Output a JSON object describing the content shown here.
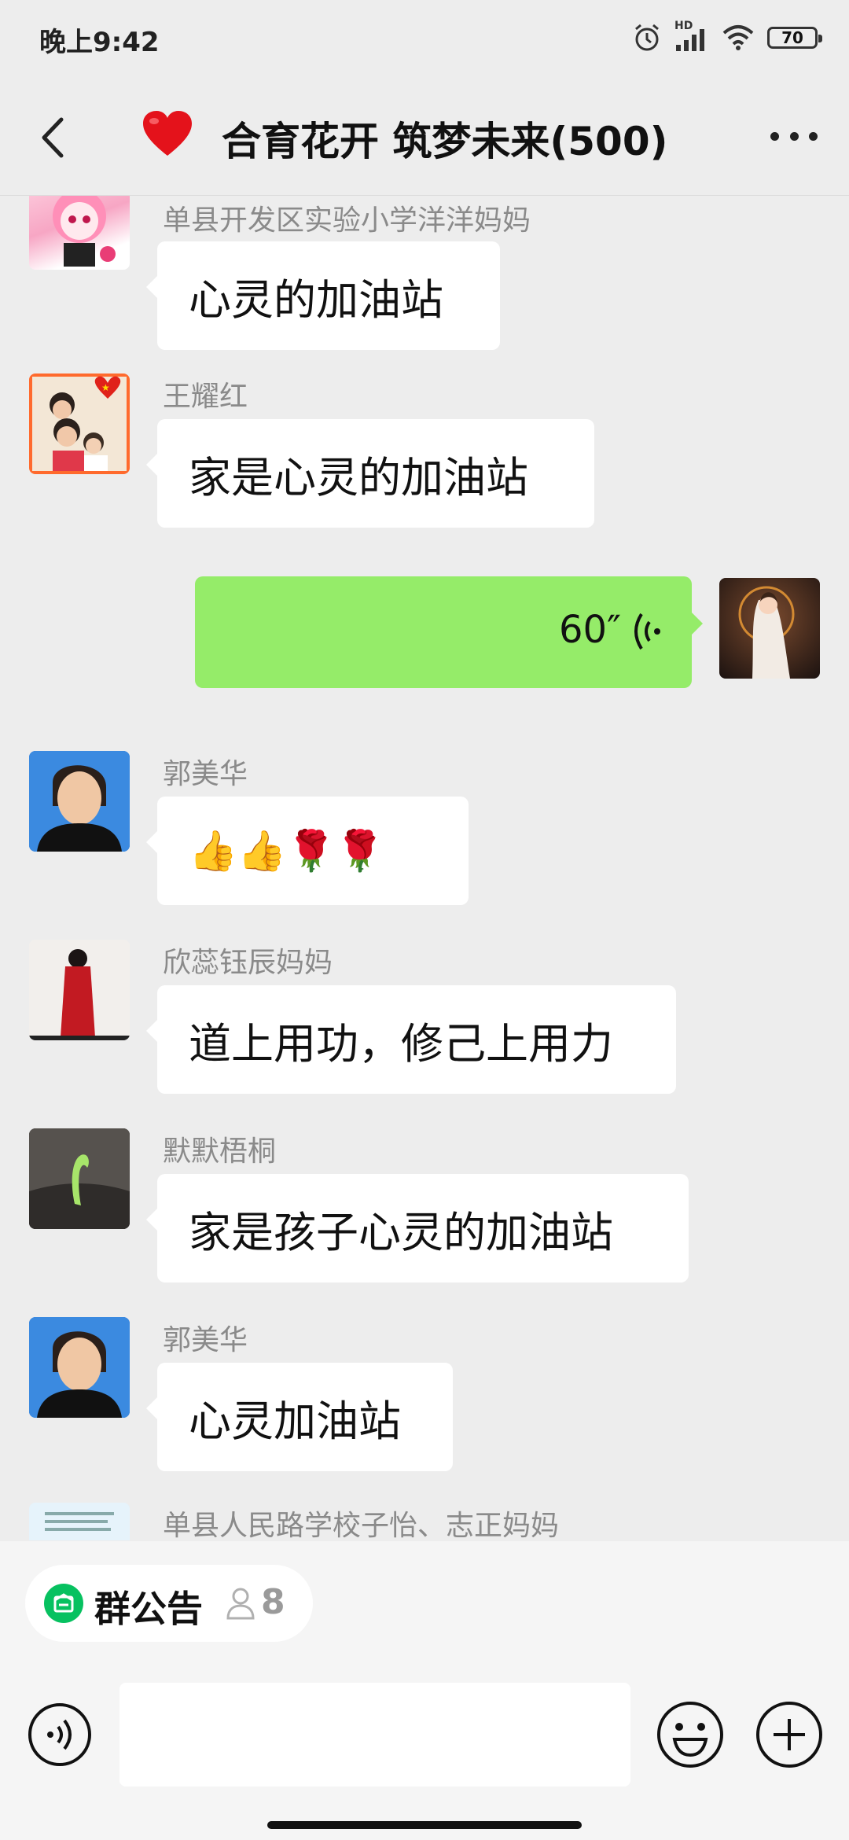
{
  "status_bar": {
    "time": "晚上9:42",
    "network_badge": "HD",
    "battery": "70"
  },
  "header": {
    "title": "合育花开 筑梦未来(500)",
    "title_icon": "heart-icon"
  },
  "messages": [
    {
      "sender": "单县开发区实验小学洋洋妈妈",
      "text": "心灵的加油站"
    },
    {
      "sender": "王耀红",
      "text": "家是心灵的加油站"
    },
    {
      "sender": "",
      "voice_duration": "60″"
    },
    {
      "sender": "郭美华",
      "text": "👍👍🌹🌹"
    },
    {
      "sender": "欣蕊钰辰妈妈",
      "text": "道上用功，修己上用力"
    },
    {
      "sender": "默默梧桐",
      "text": "家是孩子心灵的加油站"
    },
    {
      "sender": "郭美华",
      "text": "心灵加油站"
    },
    {
      "sender": "单县人民路学校子怡、志正妈妈",
      "text": ""
    }
  ],
  "announcement": {
    "label": "群公告",
    "count": "8"
  },
  "input": {
    "placeholder": ""
  },
  "colors": {
    "background": "#ededed",
    "voice_bubble": "#95ec69",
    "accent_green": "#07c160"
  }
}
